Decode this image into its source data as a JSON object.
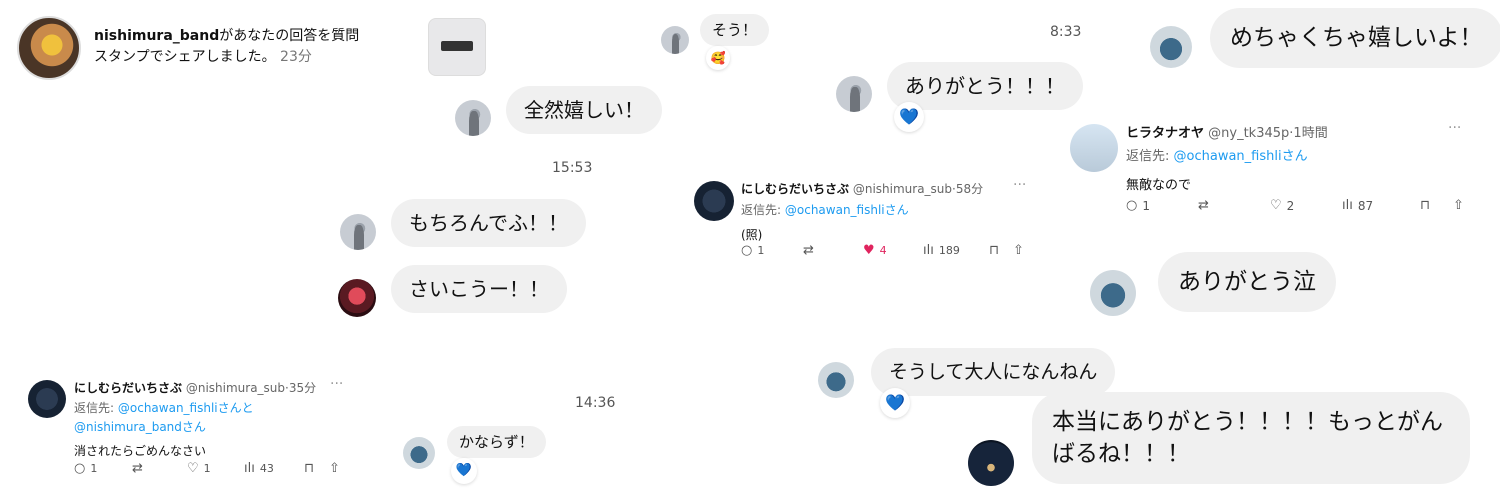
{
  "notification": {
    "user": "nishimura_band",
    "line1_rest": "があなたの回答を質問",
    "line2": "スタンプでシェアしました。",
    "ago": "23分"
  },
  "dm_left": {
    "b1": "全然嬉しい！",
    "time1": "15:53",
    "b2": "もちろんでふ！！",
    "b3": "さいこうー！！",
    "time2": "14:36",
    "b4": "かならず！"
  },
  "dm_mid": {
    "b1": "そう！",
    "time_top": "8:33",
    "b2": "ありがとう！！！",
    "b3": "そうして大人になんねん"
  },
  "dm_right": {
    "b1": "めちゃくちゃ嬉しいよ！",
    "b2": "ありがとう泣",
    "b3": "本当にありがとう！！！！もっとがんばるね！！！"
  },
  "reactions": {
    "heart": "💙",
    "smile": "🥰"
  },
  "tweet1": {
    "name": "にしむらだいちさぶ",
    "handle": "@nishimura_sub",
    "ago": "35分",
    "reply_prefix": "返信先:",
    "reply_to": "@ochawan_fishli",
    "reply_suffix": "さんと",
    "reply_to2": "@nishimura_band",
    "reply_suffix2": "さん",
    "text": "消されたらごめんなさい",
    "replies": "1",
    "likes": "1",
    "views": "43"
  },
  "tweet2": {
    "name": "にしむらだいちさぶ",
    "handle": "@nishimura_sub",
    "ago": "58分",
    "reply_prefix": "返信先:",
    "reply_to": "@ochawan_fishli",
    "reply_suffix": "さん",
    "text": "(照)",
    "replies": "1",
    "likes": "4",
    "views": "189"
  },
  "tweet3": {
    "name": "ヒラタナオヤ",
    "handle": "@ny_tk345p",
    "ago": "1時間",
    "reply_prefix": "返信先:",
    "reply_to": "@ochawan_fishli",
    "reply_suffix": "さん",
    "text": "無敵なので",
    "replies": "1",
    "likes": "2",
    "views": "87"
  },
  "icons": {
    "more": "···",
    "reply": "○",
    "retweet": "⇄",
    "like": "♡",
    "like_on": "♥",
    "views": "ılı",
    "bookmark": "⊓",
    "share": "⇧"
  }
}
